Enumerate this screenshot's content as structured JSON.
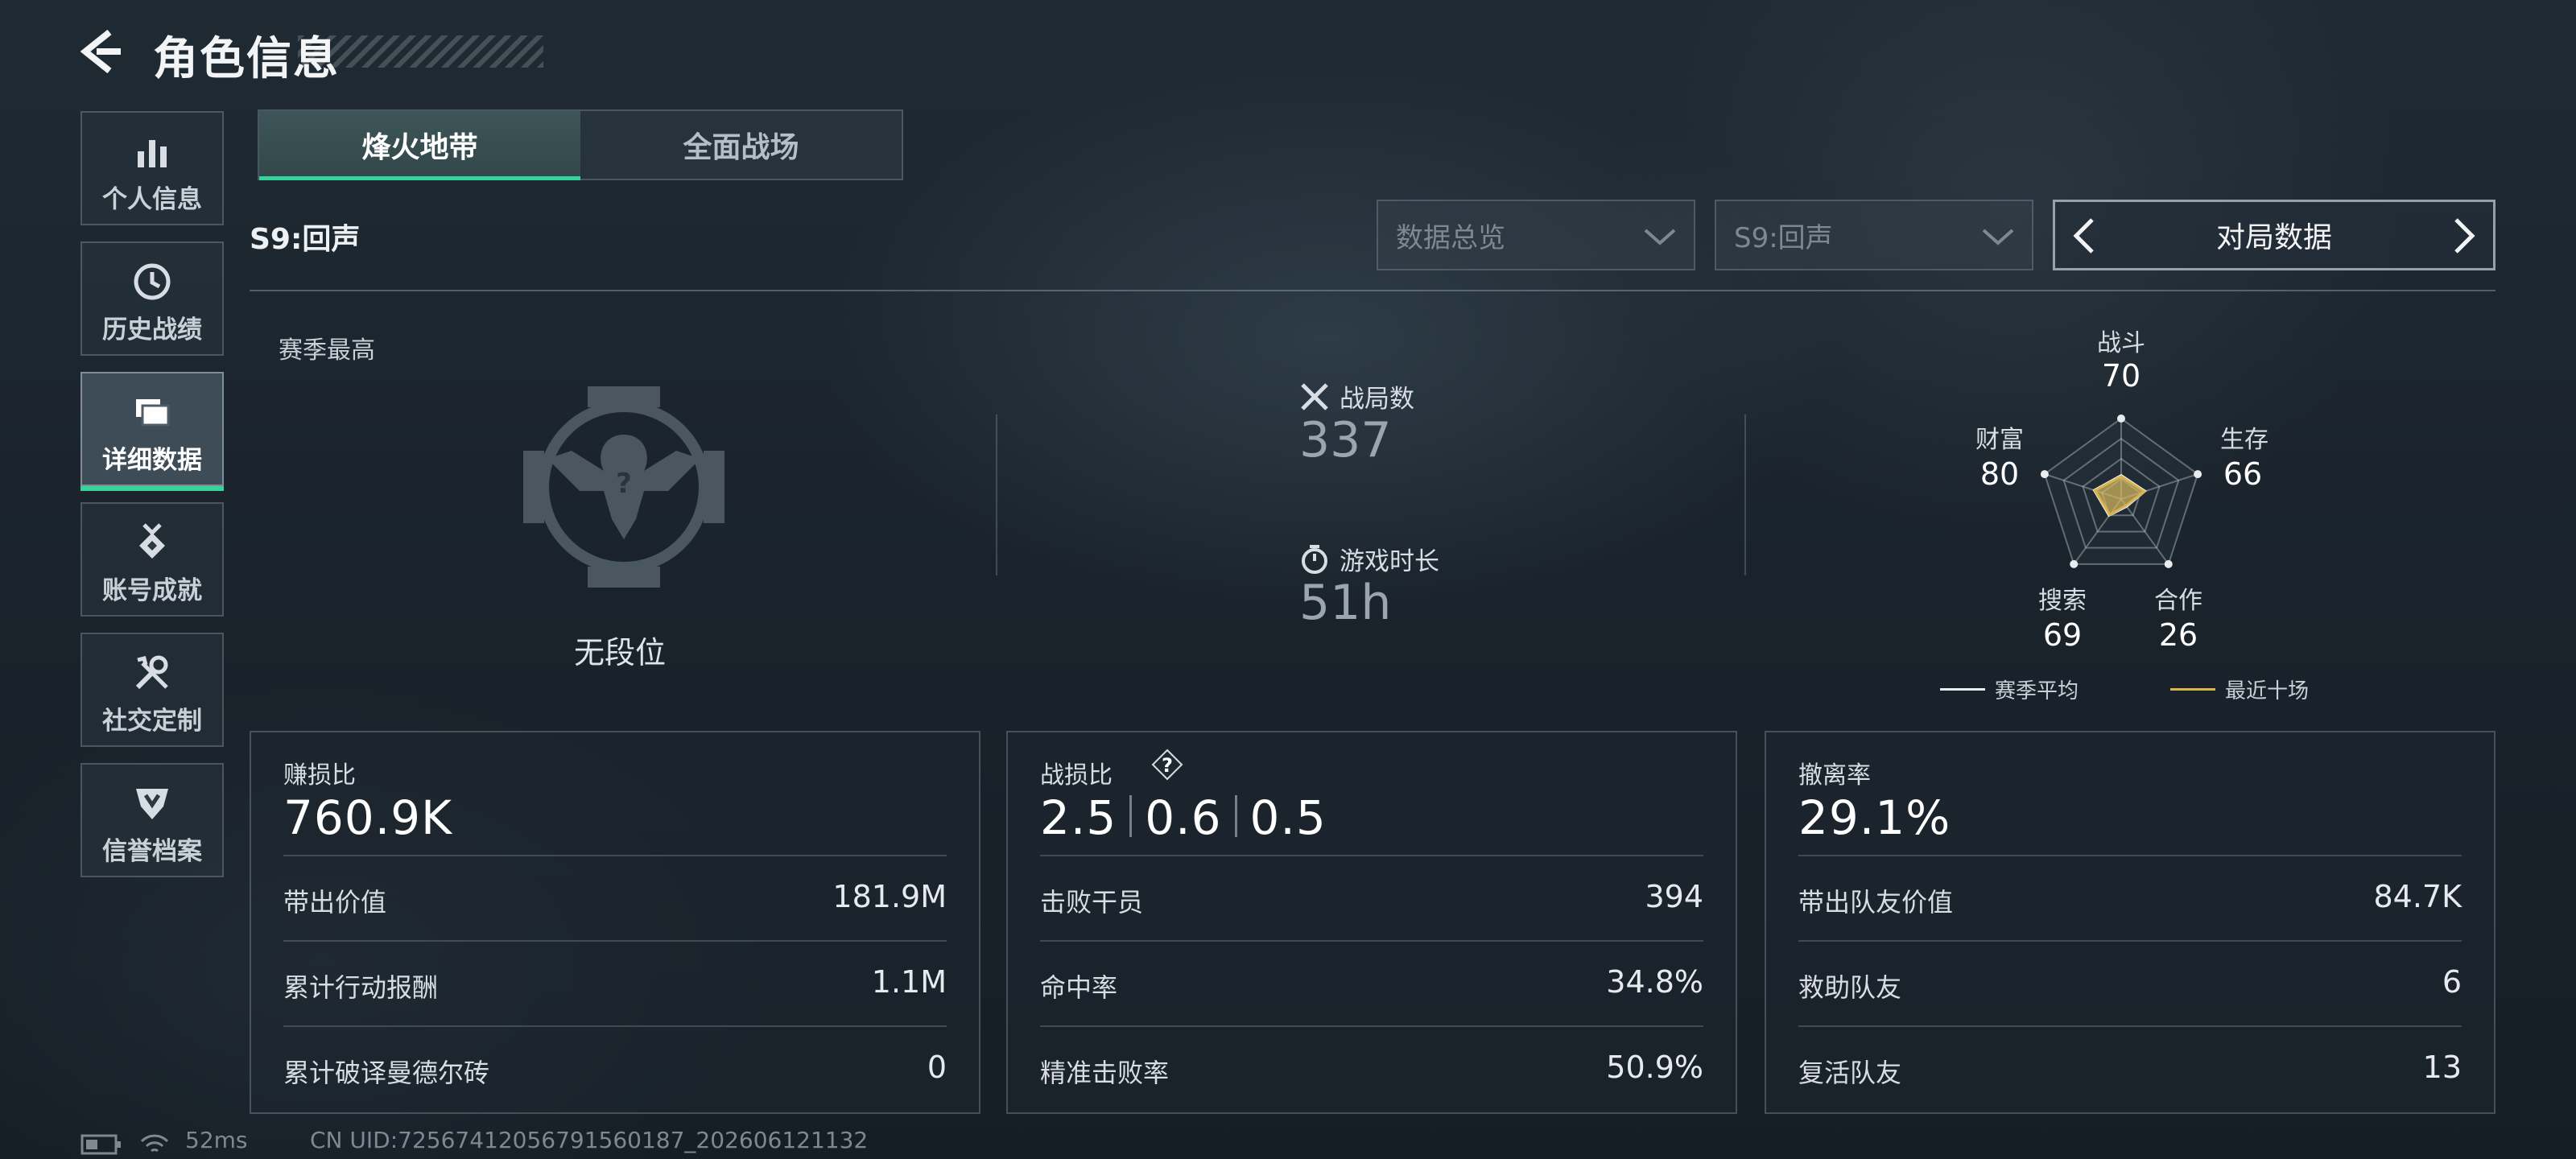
{
  "header": {
    "title": "角色信息"
  },
  "sidebar": {
    "items": [
      {
        "label": "个人信息",
        "icon": "bar-chart-icon",
        "active": false
      },
      {
        "label": "历史战绩",
        "icon": "clock-icon",
        "active": false
      },
      {
        "label": "详细数据",
        "icon": "folders-icon",
        "active": true
      },
      {
        "label": "账号成就",
        "icon": "medal-icon",
        "active": false
      },
      {
        "label": "社交定制",
        "icon": "tools-icon",
        "active": false
      },
      {
        "label": "信誉档案",
        "icon": "shield-badge-icon",
        "active": false
      }
    ]
  },
  "mode_tabs": [
    {
      "label": "烽火地带",
      "active": true
    },
    {
      "label": "全面战场",
      "active": false
    }
  ],
  "season_title": "S9:回声",
  "filters": {
    "overview": "数据总览",
    "season": "S9:回声",
    "pager_label": "对局数据"
  },
  "summary": {
    "season_best_label": "赛季最高",
    "rank": "无段位",
    "matches_label": "战局数",
    "matches_value": "337",
    "playtime_label": "游戏时长",
    "playtime_value": "51h"
  },
  "radar": {
    "axes": [
      {
        "label": "战斗",
        "value": "70"
      },
      {
        "label": "生存",
        "value": "66"
      },
      {
        "label": "合作",
        "value": "26"
      },
      {
        "label": "搜索",
        "value": "69"
      },
      {
        "label": "财富",
        "value": "80"
      }
    ],
    "legend": [
      {
        "label": "赛季平均",
        "color": "#e8ecef"
      },
      {
        "label": "最近十场",
        "color": "#d9b44a"
      }
    ],
    "series": {
      "season_avg": [
        0.3,
        0.32,
        0.12,
        0.26,
        0.36
      ],
      "recent_ten": [
        0.28,
        0.3,
        0.1,
        0.24,
        0.34
      ]
    }
  },
  "panels": {
    "profit": {
      "label": "赚损比",
      "value": "760.9K",
      "rows": [
        {
          "k": "带出价值",
          "v": "181.9M"
        },
        {
          "k": "累计行动报酬",
          "v": "1.1M"
        },
        {
          "k": "累计破译曼德尔砖",
          "v": "0"
        }
      ]
    },
    "combat": {
      "label": "战损比",
      "values": [
        "2.5",
        "0.6",
        "0.5"
      ],
      "help_icon": "question-icon",
      "rows": [
        {
          "k": "击败干员",
          "v": "394"
        },
        {
          "k": "命中率",
          "v": "34.8%"
        },
        {
          "k": "精准击败率",
          "v": "50.9%"
        }
      ]
    },
    "extract": {
      "label": "撤离率",
      "value": "29.1%",
      "rows": [
        {
          "k": "带出队友价值",
          "v": "84.7K"
        },
        {
          "k": "救助队友",
          "v": "6"
        },
        {
          "k": "复活队友",
          "v": "13"
        }
      ]
    }
  },
  "footer": {
    "ping": "52ms",
    "uid": "CN UID:72567412056791560187_202606121132"
  },
  "colors": {
    "accent": "#35d49a",
    "recent": "#d9b44a"
  }
}
